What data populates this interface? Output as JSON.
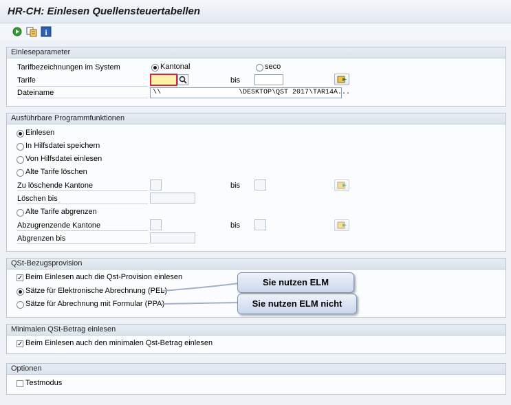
{
  "window": {
    "title": "HR-CH: Einlesen Quellensteuertabellen"
  },
  "toolbar": {
    "icons": [
      "execute-icon",
      "variant-icon",
      "info-icon"
    ]
  },
  "einleseparameter": {
    "header": "Einleseparameter",
    "tarif_system_label": "Tarifbezeichnungen im System",
    "radio_kantonal": "Kantonal",
    "radio_seco": "seco",
    "tarife_label": "Tarife",
    "bis_label": "bis",
    "dateiname_label": "Dateiname",
    "dateiname_value_left": "\\\\",
    "dateiname_value_right": "\\DESKTOP\\QST 2017\\TAR14A..."
  },
  "programmfunktionen": {
    "header": "Ausführbare Programmfunktionen",
    "einlesen": "Einlesen",
    "hilfsdatei_speichern": "In Hilfsdatei speichern",
    "hilfsdatei_einlesen": "Von Hilfsdatei einlesen",
    "alte_tarife_loeschen": "Alte Tarife löschen",
    "zu_loeschende_kantone": "Zu löschende Kantone",
    "bis1": "bis",
    "loeschen_bis": "Löschen bis",
    "alte_tarife_abgrenzen": "Alte Tarife abgrenzen",
    "abzugrenzende_kantone": "Abzugrenzende Kantone",
    "bis2": "bis",
    "abgrenzen_bis": "Abgrenzen bis"
  },
  "bezugsprovision": {
    "header": "QSt-Bezugsprovision",
    "check_provision": "Beim Einlesen auch die Qst-Provision einlesen",
    "radio_pel": "Sätze für Elektronische Abrechnung (PEL)",
    "radio_ppa": "Sätze für Abrechnung mit Formular (PPA)"
  },
  "callouts": {
    "elm": "Sie nutzen ELM",
    "elm_nicht": "Sie nutzen ELM nicht"
  },
  "minimal": {
    "header": "Minimalen QSt-Betrag einlesen",
    "check_minimal": "Beim Einlesen auch den minimalen Qst-Betrag einlesen"
  },
  "optionen": {
    "header": "Optionen",
    "testmodus": "Testmodus"
  },
  "colors": {
    "required_field": "#fff2a6",
    "required_border": "#d4253f",
    "group_header": "#dbe3ec"
  }
}
